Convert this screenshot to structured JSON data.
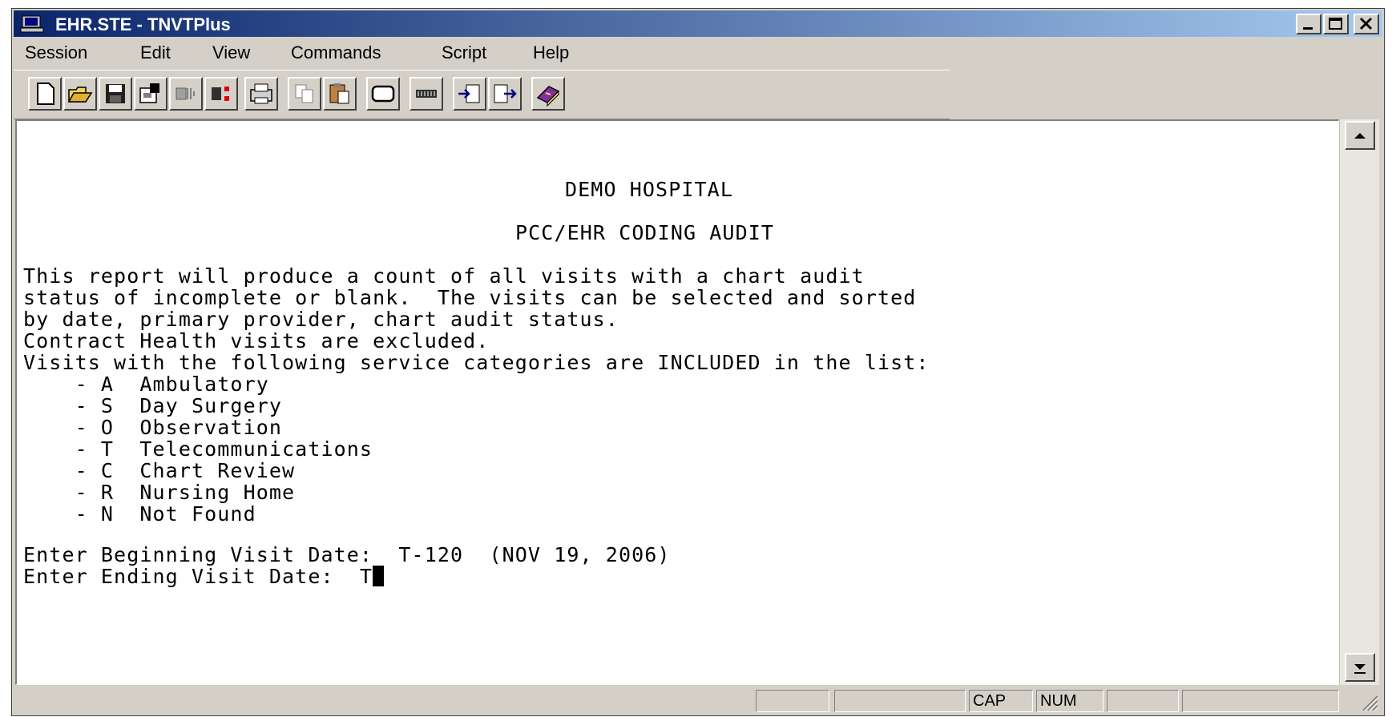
{
  "window": {
    "title": "EHR.STE - TNVTPlus",
    "controls": {
      "minimize": "minimize",
      "maximize": "maximize",
      "close": "close"
    }
  },
  "menu": [
    "Session",
    "Edit",
    "View",
    "Commands",
    "Script",
    "Help"
  ],
  "toolbar": {
    "buttons": [
      "new-file-icon",
      "open-folder-icon",
      "save-disk-icon",
      "properties-icon",
      "connect-icon",
      "disconnect-icon",
      "print-icon",
      "copy-icon",
      "paste-icon",
      "screen-icon",
      "keyboard-icon",
      "send-file-icon",
      "receive-file-icon",
      "book-icon"
    ]
  },
  "terminal": {
    "header1": "DEMO HOSPITAL",
    "header2": "PCC/EHR CODING AUDIT",
    "intro": [
      "This report will produce a count of all visits with a chart audit",
      "status of incomplete or blank.  The visits can be selected and sorted",
      "by date, primary provider, chart audit status.",
      "Contract Health visits are excluded.",
      "Visits with the following service categories are INCLUDED in the list:"
    ],
    "categories": [
      "    - A  Ambulatory",
      "    - S  Day Surgery",
      "    - O  Observation",
      "    - T  Telecommunications",
      "    - C  Chart Review",
      "    - R  Nursing Home",
      "    - N  Not Found"
    ],
    "prompt_begin": "Enter Beginning Visit Date:  T-120  (NOV 19, 2006)",
    "prompt_end": "Enter Ending Visit Date:  T"
  },
  "statusbar": {
    "cap": "CAP",
    "num": "NUM"
  },
  "colors": {
    "titlebar_start": "#0a246a",
    "titlebar_end": "#a6caf0",
    "chrome": "#d4d0c8",
    "terminal_bg": "#ffffff"
  }
}
